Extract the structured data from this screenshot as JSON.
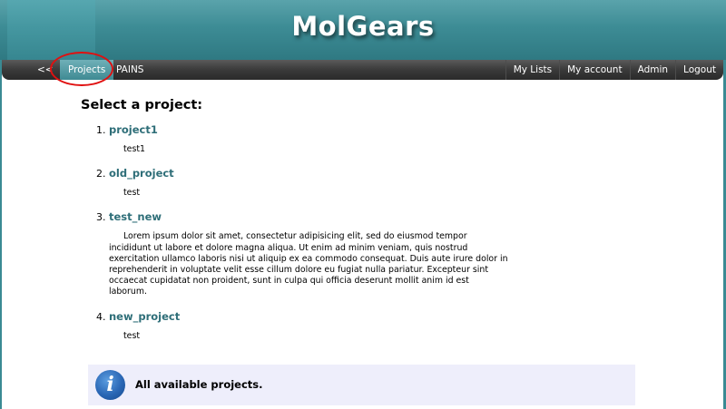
{
  "header": {
    "title": "MolGears"
  },
  "nav": {
    "back": "<<",
    "projects": "Projects",
    "pains": "PAINS",
    "right": [
      "My Lists",
      "My account",
      "Admin",
      "Logout"
    ]
  },
  "main": {
    "heading": "Select a project:",
    "projects": [
      {
        "name": "project1",
        "description": "test1"
      },
      {
        "name": "old_project",
        "description": "test"
      },
      {
        "name": "test_new",
        "description": "Lorem ipsum dolor sit amet, consectetur adipisicing elit, sed do eiusmod tempor incididunt ut labore et dolore magna aliqua. Ut enim ad minim veniam, quis nostrud exercitation ullamco laboris nisi ut aliquip ex ea commodo consequat. Duis aute irure dolor in reprehenderit in voluptate velit esse cillum dolore eu fugiat nulla pariatur. Excepteur sint occaecat cupidatat non proident, sunt in culpa qui officia deserunt mollit anim id est laborum."
      },
      {
        "name": "new_project",
        "description": "test"
      }
    ]
  },
  "info": {
    "icon": "info-icon",
    "text": "All available projects."
  },
  "colors": {
    "header": "#3d8c95",
    "navbar": "#3a3a3a",
    "link": "#2e6e78",
    "info_bg": "#eeeefb",
    "highlight": "#e01010"
  }
}
